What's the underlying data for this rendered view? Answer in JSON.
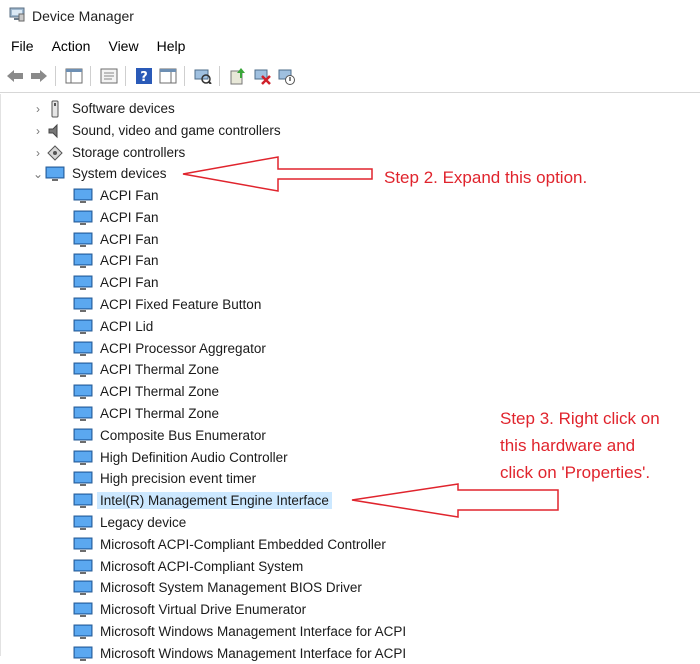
{
  "window": {
    "title": "Device Manager"
  },
  "menubar": {
    "items": [
      "File",
      "Action",
      "View",
      "Help"
    ]
  },
  "toolbar": {
    "buttons": [
      "back-icon",
      "forward-icon",
      "show-hide-tree-icon",
      "properties-icon",
      "help-icon",
      "action-pane-icon",
      "scan-hardware-icon",
      "update-driver-icon",
      "uninstall-device-icon",
      "disable-device-icon"
    ]
  },
  "tree": {
    "collapsed_categories": [
      {
        "label": "Software devices",
        "icon": "software-device-icon"
      },
      {
        "label": "Sound, video and game controllers",
        "icon": "speaker-icon"
      },
      {
        "label": "Storage controllers",
        "icon": "storage-controller-icon"
      }
    ],
    "expanded_category": {
      "label": "System devices",
      "icon": "monitor-icon"
    },
    "children": [
      "ACPI Fan",
      "ACPI Fan",
      "ACPI Fan",
      "ACPI Fan",
      "ACPI Fan",
      "ACPI Fixed Feature Button",
      "ACPI Lid",
      "ACPI Processor Aggregator",
      "ACPI Thermal Zone",
      "ACPI Thermal Zone",
      "ACPI Thermal Zone",
      "Composite Bus Enumerator",
      "High Definition Audio Controller",
      "High precision event timer",
      "Intel(R) Management Engine Interface",
      "Legacy device",
      "Microsoft ACPI-Compliant Embedded Controller",
      "Microsoft ACPI-Compliant System",
      "Microsoft System Management BIOS Driver",
      "Microsoft Virtual Drive Enumerator",
      "Microsoft Windows Management Interface for ACPI",
      "Microsoft Windows Management Interface for ACPI"
    ],
    "selected_child": "Intel(R) Management Engine Interface"
  },
  "annotations": {
    "step2": "Step 2. Expand this option.",
    "step3_lines": [
      "Step 3. Right click on",
      "this hardware and",
      "click on 'Properties'."
    ],
    "color": "#e0242d"
  }
}
